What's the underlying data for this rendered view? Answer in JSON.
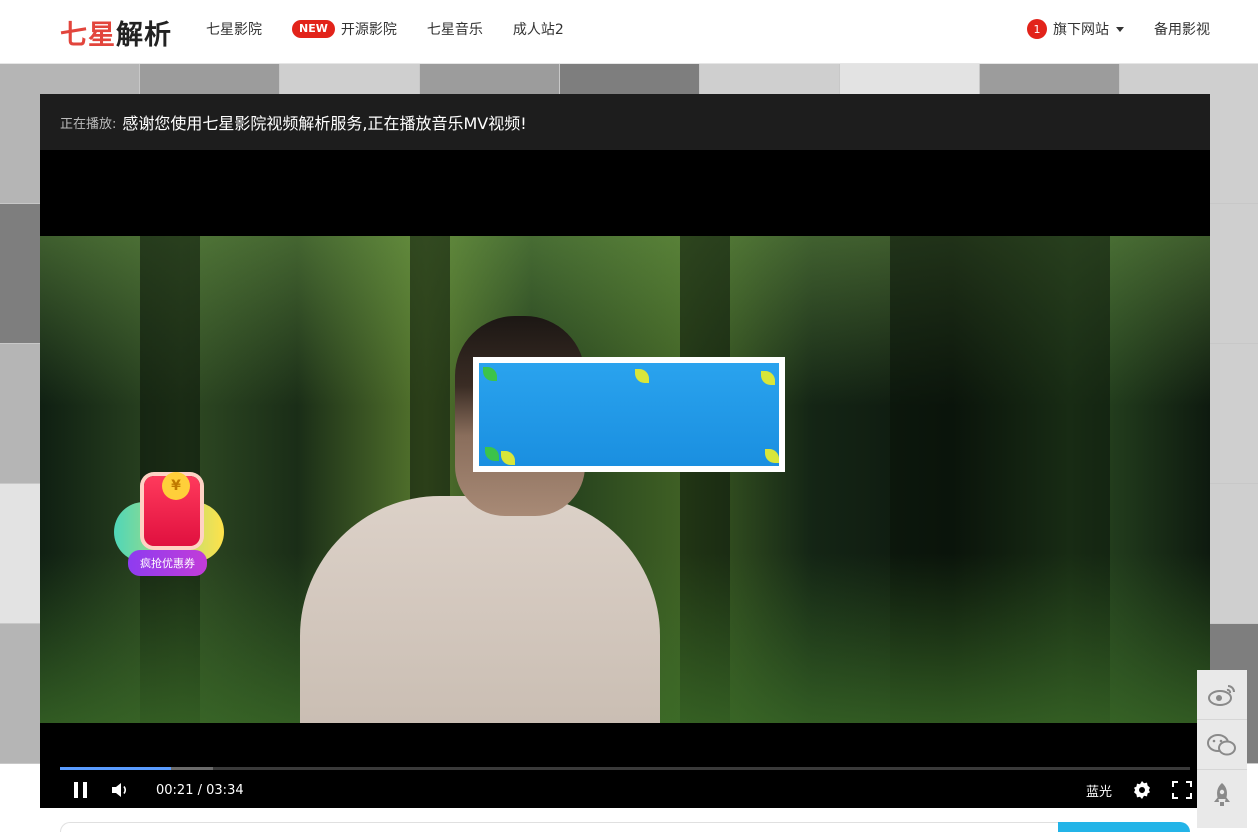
{
  "header": {
    "logo_part1": "七星",
    "logo_part2": "解析",
    "nav": [
      {
        "label": "七星影院"
      },
      {
        "badge": "NEW",
        "label": "开源影院"
      },
      {
        "label": "七星音乐"
      },
      {
        "label": "成人站2"
      }
    ],
    "dropdown": {
      "count": "1",
      "label": "旗下网站"
    },
    "backup_label": "备用影视"
  },
  "player": {
    "now_playing_label": "正在播放:",
    "now_playing_title": "感谢您使用七星影院视频解析服务,正在播放音乐MV视频!",
    "current_time": "00:21",
    "separator": "/",
    "duration": "03:34",
    "progress_fraction": 0.098,
    "buffered_fraction": 0.135,
    "quality": "蓝光"
  },
  "promo": {
    "coin_symbol": "¥",
    "label": "疯抢优惠券"
  },
  "icons": {
    "weibo": "weibo-icon",
    "wechat": "wechat-icon",
    "rocket": "rocket-icon"
  },
  "colors": {
    "brand_red": "#e2453c",
    "progress": "#5a9cff",
    "search_button": "#23b4e8"
  }
}
